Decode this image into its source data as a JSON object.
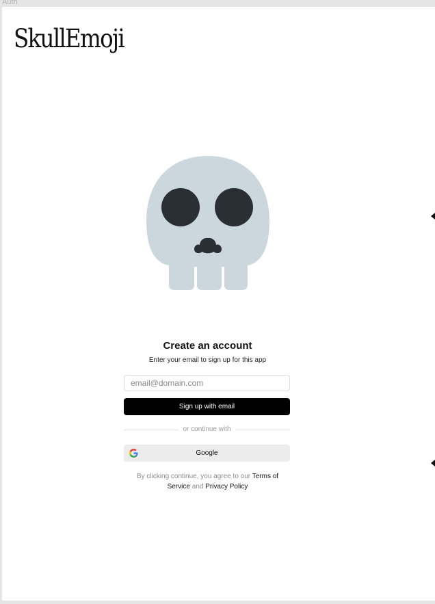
{
  "frame": {
    "label": "Auth"
  },
  "brand": {
    "logo": "SkullEmoji"
  },
  "illustration": {
    "icon": "skull-icon"
  },
  "auth": {
    "title": "Create an account",
    "subtitle": "Enter your email to sign up for this app",
    "email_placeholder": "email@domain.com",
    "email_value": "",
    "signup_label": "Sign up with email",
    "divider_text": "or continue with",
    "google_label": "Google",
    "google_icon": "google-icon",
    "terms_prefix": "By clicking continue, you agree to our",
    "terms_link": "Terms of Service",
    "terms_and": "and",
    "privacy_link": "Privacy Policy"
  },
  "colors": {
    "skull": "#ccd6dd",
    "skull_features": "#292f33",
    "primary_button": "#000000",
    "secondary_button": "#ececec"
  }
}
